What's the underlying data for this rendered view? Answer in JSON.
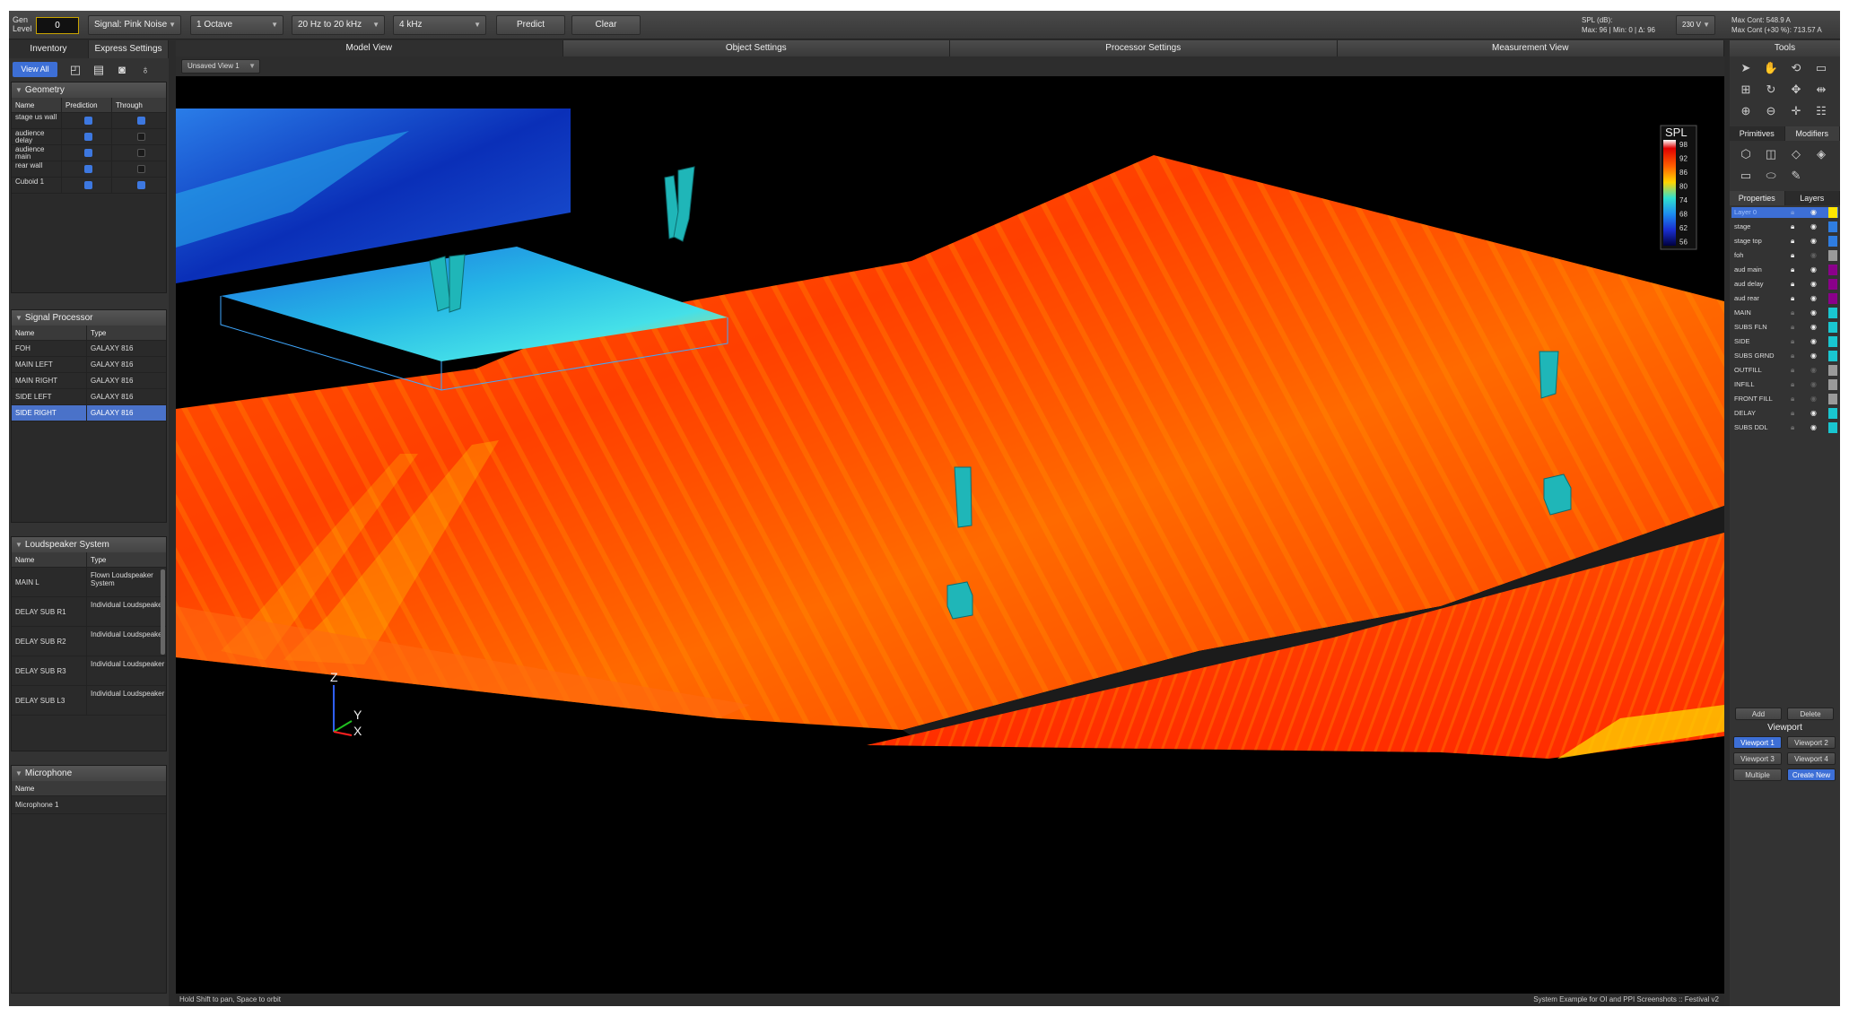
{
  "topbar": {
    "gen_label_1": "Gen",
    "gen_label_2": "Level",
    "gen_value": "0",
    "signal": "Signal: Pink Noise",
    "resolution": "1 Octave",
    "freq_range": "20 Hz to 20 kHz",
    "freq": "4 kHz",
    "predict": "Predict",
    "clear": "Clear",
    "spl_label": "SPL (dB):",
    "spl_stats": "Max: 96 | Min: 0 | Δ: 96",
    "voltage": "230 V",
    "max_cont": "Max Cont: 548.9  A",
    "max_cont_30": "Max Cont (+30 %): 713.57  A"
  },
  "left": {
    "tab_inventory": "Inventory",
    "tab_express": "Express Settings",
    "view_all": "View All",
    "geometry": {
      "title": "Geometry",
      "headers": [
        "Name",
        "Prediction",
        "Through"
      ],
      "rows": [
        {
          "name": "stage us wall",
          "prediction": true,
          "through": true
        },
        {
          "name": "audience delay",
          "prediction": true,
          "through": false
        },
        {
          "name": "audience main",
          "prediction": true,
          "through": false
        },
        {
          "name": "rear wall",
          "prediction": true,
          "through": false
        },
        {
          "name": "Cuboid 1",
          "prediction": true,
          "through": true
        }
      ]
    },
    "signal_processor": {
      "title": "Signal Processor",
      "headers": [
        "Name",
        "Type"
      ],
      "rows": [
        {
          "name": "FOH",
          "type": "GALAXY 816"
        },
        {
          "name": "MAIN LEFT",
          "type": "GALAXY 816"
        },
        {
          "name": "MAIN RIGHT",
          "type": "GALAXY 816"
        },
        {
          "name": "SIDE LEFT",
          "type": "GALAXY 816"
        },
        {
          "name": "SIDE RIGHT",
          "type": "GALAXY 816",
          "selected": true
        }
      ]
    },
    "loudspeaker": {
      "title": "Loudspeaker System",
      "headers": [
        "Name",
        "Type"
      ],
      "rows": [
        {
          "name": "MAIN L",
          "type": "Flown Loudspeaker System"
        },
        {
          "name": "DELAY SUB R1",
          "type": "Individual Loudspeaker"
        },
        {
          "name": "DELAY SUB R2",
          "type": "Individual Loudspeaker"
        },
        {
          "name": "DELAY SUB R3",
          "type": "Individual Loudspeaker"
        },
        {
          "name": "DELAY SUB L3",
          "type": "Individual Loudspeaker"
        }
      ]
    },
    "microphone": {
      "title": "Microphone",
      "header": "Name",
      "rows": [
        "Microphone 1"
      ]
    }
  },
  "center": {
    "tabs": [
      "Model View",
      "Object Settings",
      "Processor Settings",
      "Measurement View"
    ],
    "view_select": "Unsaved View 1",
    "legend": {
      "title": "SPL",
      "ticks": [
        "98",
        "92",
        "86",
        "80",
        "74",
        "68",
        "62",
        "56"
      ]
    },
    "axes": {
      "z": "Z",
      "y": "Y",
      "x": "X"
    },
    "status_left": "Hold Shift to pan, Space to orbit",
    "status_right": "System Example for OI and PPI Screenshots :: Festival v2"
  },
  "right": {
    "tools_title": "Tools",
    "primitives": "Primitives",
    "modifiers": "Modifiers",
    "properties": "Properties",
    "layers_tab": "Layers",
    "layers": [
      {
        "name": "Layer 0",
        "color": "#ffe600",
        "locked": false,
        "visible": true,
        "active": true
      },
      {
        "name": "stage",
        "color": "#2f7de0",
        "locked": true,
        "visible": true
      },
      {
        "name": "stage top",
        "color": "#2f7de0",
        "locked": true,
        "visible": true
      },
      {
        "name": "foh",
        "color": "#9a9a9a",
        "locked": true,
        "visible": false
      },
      {
        "name": "aud main",
        "color": "#8a008a",
        "locked": true,
        "visible": true
      },
      {
        "name": "aud delay",
        "color": "#8a008a",
        "locked": true,
        "visible": true
      },
      {
        "name": "aud rear",
        "color": "#8a008a",
        "locked": true,
        "visible": true
      },
      {
        "name": "MAIN",
        "color": "#19c6d0",
        "locked": false,
        "visible": true
      },
      {
        "name": "SUBS FLN",
        "color": "#19c6d0",
        "locked": false,
        "visible": true
      },
      {
        "name": "SIDE",
        "color": "#19c6d0",
        "locked": false,
        "visible": true
      },
      {
        "name": "SUBS GRND",
        "color": "#19c6d0",
        "locked": false,
        "visible": true
      },
      {
        "name": "OUTFILL",
        "color": "#9a9a9a",
        "locked": false,
        "visible": false
      },
      {
        "name": "INFILL",
        "color": "#9a9a9a",
        "locked": false,
        "visible": false
      },
      {
        "name": "FRONT FILL",
        "color": "#9a9a9a",
        "locked": false,
        "visible": false
      },
      {
        "name": "DELAY",
        "color": "#19c6d0",
        "locked": false,
        "visible": true
      },
      {
        "name": "SUBS DDL",
        "color": "#19c6d0",
        "locked": false,
        "visible": true
      }
    ],
    "add": "Add",
    "delete": "Delete",
    "viewport_title": "Viewport",
    "viewports": [
      "Viewport 1",
      "Viewport 2",
      "Viewport 3",
      "Viewport 4"
    ],
    "multiple": "Multiple",
    "create_new": "Create New"
  }
}
